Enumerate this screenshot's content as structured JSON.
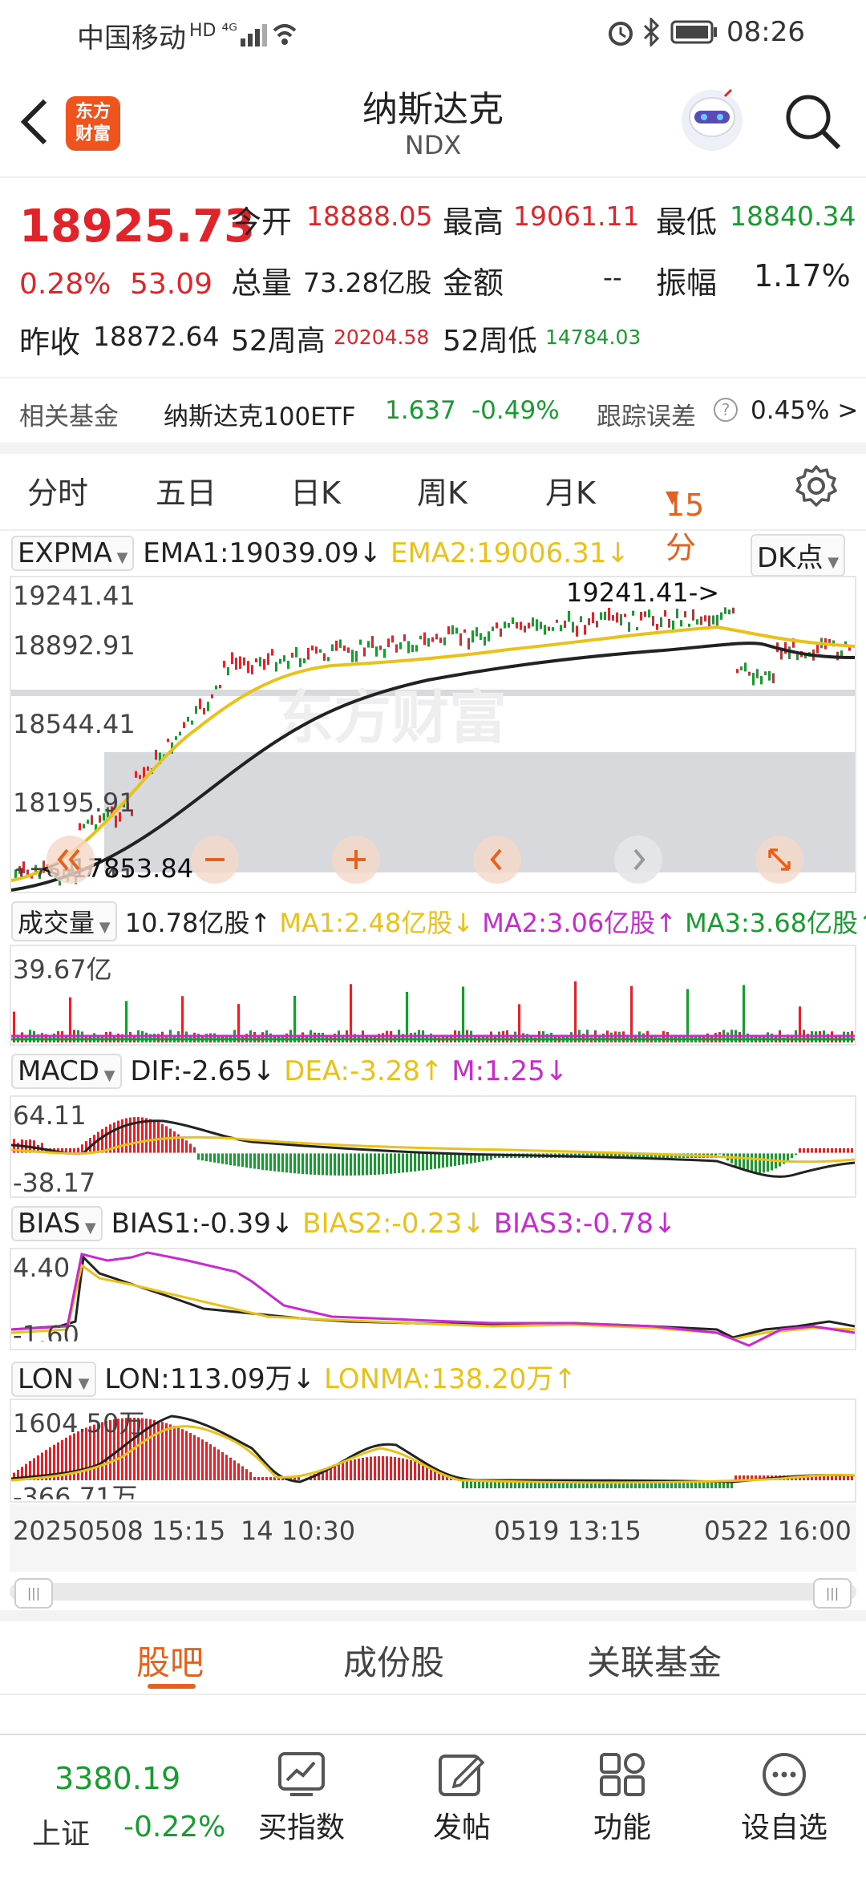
{
  "status_bar": {
    "carrier": "中国移动",
    "net": "HD ⁴ᴳ",
    "time": "08:26"
  },
  "header": {
    "logo_line1": "东方",
    "logo_line2": "财富",
    "title": "纳斯达克",
    "code": "NDX"
  },
  "quote": {
    "price": "18925.73",
    "change_pct": "0.28%",
    "change": "53.09",
    "open_label": "今开",
    "open": "18888.05",
    "high_label": "最高",
    "high": "19061.11",
    "low_label": "最低",
    "low": "18840.34",
    "volume_label": "总量",
    "volume": "73.28亿股",
    "amount_label": "金额",
    "amount": "--",
    "amplitude_label": "振幅",
    "amplitude": "1.17%",
    "prev_close_label": "昨收",
    "prev_close": "18872.64",
    "high52_label": "52周高",
    "high52": "20204.58",
    "low52_label": "52周低",
    "low52": "14784.03"
  },
  "fund": {
    "label": "相关基金",
    "name": "纳斯达克100ETF",
    "price": "1.637",
    "change": "-0.49%",
    "tracking_label": "跟踪误差",
    "tracking": "0.45% >"
  },
  "tabs": [
    "分时",
    "五日",
    "日K",
    "周K",
    "月K",
    "15分"
  ],
  "main_chart": {
    "indicator": "EXPMA",
    "ema1": "EMA1:19039.09↓",
    "ema2": "EMA2:19006.31↓",
    "dk_button": "DK点",
    "y_labels": [
      "19241.41",
      "18892.91",
      "18544.41",
      "18195.91",
      "17847.41"
    ],
    "high_marker": "19241.41->",
    "low_marker": "<-17853.84",
    "watermark": "东方财富"
  },
  "volume": {
    "indicator": "成交量",
    "value": "10.78亿股↑",
    "ma1": "MA1:2.48亿股↓",
    "ma2": "MA2:3.06亿股↑",
    "ma3": "MA3:3.68亿股↑",
    "y_label": "39.67亿"
  },
  "macd": {
    "indicator": "MACD",
    "dif": "DIF:-2.65↓",
    "dea": "DEA:-3.28↑",
    "m": "M:1.25↓",
    "y_top": "64.11",
    "y_bottom": "-38.17"
  },
  "bias": {
    "indicator": "BIAS",
    "b1": "BIAS1:-0.39↓",
    "b2": "BIAS2:-0.23↓",
    "b3": "BIAS3:-0.78↓",
    "y_top": "4.40",
    "y_bottom": "-1.60"
  },
  "lon": {
    "indicator": "LON",
    "lon": "LON:113.09万↓",
    "lonma": "LONMA:138.20万↑",
    "y_top": "1604.50万",
    "y_bottom": "-366.71万"
  },
  "x_axis": [
    "20250508 15:15",
    "14 10:30",
    "0519 13:15",
    "0522 16:00"
  ],
  "bottom_tabs": [
    "股吧",
    "成份股",
    "关联基金"
  ],
  "nav": {
    "index_value": "3380.19",
    "index_name": "上证",
    "index_change": "-0.22%",
    "items": [
      "买指数",
      "发帖",
      "功能",
      "设自选"
    ]
  },
  "colors": {
    "up": "#e0242a",
    "down": "#169c2f",
    "accent": "#e8601c",
    "ema2": "#e8c21a",
    "magenta": "#c82ad0"
  }
}
